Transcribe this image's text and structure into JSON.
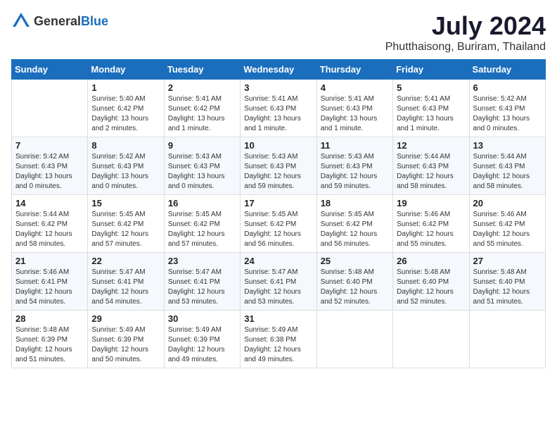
{
  "header": {
    "logo_general": "General",
    "logo_blue": "Blue",
    "month_title": "July 2024",
    "location": "Phutthaisong, Buriram, Thailand"
  },
  "days_of_week": [
    "Sunday",
    "Monday",
    "Tuesday",
    "Wednesday",
    "Thursday",
    "Friday",
    "Saturday"
  ],
  "weeks": [
    [
      {
        "day": "",
        "info": ""
      },
      {
        "day": "1",
        "info": "Sunrise: 5:40 AM\nSunset: 6:42 PM\nDaylight: 13 hours\nand 2 minutes."
      },
      {
        "day": "2",
        "info": "Sunrise: 5:41 AM\nSunset: 6:42 PM\nDaylight: 13 hours\nand 1 minute."
      },
      {
        "day": "3",
        "info": "Sunrise: 5:41 AM\nSunset: 6:43 PM\nDaylight: 13 hours\nand 1 minute."
      },
      {
        "day": "4",
        "info": "Sunrise: 5:41 AM\nSunset: 6:43 PM\nDaylight: 13 hours\nand 1 minute."
      },
      {
        "day": "5",
        "info": "Sunrise: 5:41 AM\nSunset: 6:43 PM\nDaylight: 13 hours\nand 1 minute."
      },
      {
        "day": "6",
        "info": "Sunrise: 5:42 AM\nSunset: 6:43 PM\nDaylight: 13 hours\nand 0 minutes."
      }
    ],
    [
      {
        "day": "7",
        "info": "Sunrise: 5:42 AM\nSunset: 6:43 PM\nDaylight: 13 hours\nand 0 minutes."
      },
      {
        "day": "8",
        "info": "Sunrise: 5:42 AM\nSunset: 6:43 PM\nDaylight: 13 hours\nand 0 minutes."
      },
      {
        "day": "9",
        "info": "Sunrise: 5:43 AM\nSunset: 6:43 PM\nDaylight: 13 hours\nand 0 minutes."
      },
      {
        "day": "10",
        "info": "Sunrise: 5:43 AM\nSunset: 6:43 PM\nDaylight: 12 hours\nand 59 minutes."
      },
      {
        "day": "11",
        "info": "Sunrise: 5:43 AM\nSunset: 6:43 PM\nDaylight: 12 hours\nand 59 minutes."
      },
      {
        "day": "12",
        "info": "Sunrise: 5:44 AM\nSunset: 6:43 PM\nDaylight: 12 hours\nand 58 minutes."
      },
      {
        "day": "13",
        "info": "Sunrise: 5:44 AM\nSunset: 6:43 PM\nDaylight: 12 hours\nand 58 minutes."
      }
    ],
    [
      {
        "day": "14",
        "info": "Sunrise: 5:44 AM\nSunset: 6:42 PM\nDaylight: 12 hours\nand 58 minutes."
      },
      {
        "day": "15",
        "info": "Sunrise: 5:45 AM\nSunset: 6:42 PM\nDaylight: 12 hours\nand 57 minutes."
      },
      {
        "day": "16",
        "info": "Sunrise: 5:45 AM\nSunset: 6:42 PM\nDaylight: 12 hours\nand 57 minutes."
      },
      {
        "day": "17",
        "info": "Sunrise: 5:45 AM\nSunset: 6:42 PM\nDaylight: 12 hours\nand 56 minutes."
      },
      {
        "day": "18",
        "info": "Sunrise: 5:45 AM\nSunset: 6:42 PM\nDaylight: 12 hours\nand 56 minutes."
      },
      {
        "day": "19",
        "info": "Sunrise: 5:46 AM\nSunset: 6:42 PM\nDaylight: 12 hours\nand 55 minutes."
      },
      {
        "day": "20",
        "info": "Sunrise: 5:46 AM\nSunset: 6:42 PM\nDaylight: 12 hours\nand 55 minutes."
      }
    ],
    [
      {
        "day": "21",
        "info": "Sunrise: 5:46 AM\nSunset: 6:41 PM\nDaylight: 12 hours\nand 54 minutes."
      },
      {
        "day": "22",
        "info": "Sunrise: 5:47 AM\nSunset: 6:41 PM\nDaylight: 12 hours\nand 54 minutes."
      },
      {
        "day": "23",
        "info": "Sunrise: 5:47 AM\nSunset: 6:41 PM\nDaylight: 12 hours\nand 53 minutes."
      },
      {
        "day": "24",
        "info": "Sunrise: 5:47 AM\nSunset: 6:41 PM\nDaylight: 12 hours\nand 53 minutes."
      },
      {
        "day": "25",
        "info": "Sunrise: 5:48 AM\nSunset: 6:40 PM\nDaylight: 12 hours\nand 52 minutes."
      },
      {
        "day": "26",
        "info": "Sunrise: 5:48 AM\nSunset: 6:40 PM\nDaylight: 12 hours\nand 52 minutes."
      },
      {
        "day": "27",
        "info": "Sunrise: 5:48 AM\nSunset: 6:40 PM\nDaylight: 12 hours\nand 51 minutes."
      }
    ],
    [
      {
        "day": "28",
        "info": "Sunrise: 5:48 AM\nSunset: 6:39 PM\nDaylight: 12 hours\nand 51 minutes."
      },
      {
        "day": "29",
        "info": "Sunrise: 5:49 AM\nSunset: 6:39 PM\nDaylight: 12 hours\nand 50 minutes."
      },
      {
        "day": "30",
        "info": "Sunrise: 5:49 AM\nSunset: 6:39 PM\nDaylight: 12 hours\nand 49 minutes."
      },
      {
        "day": "31",
        "info": "Sunrise: 5:49 AM\nSunset: 6:38 PM\nDaylight: 12 hours\nand 49 minutes."
      },
      {
        "day": "",
        "info": ""
      },
      {
        "day": "",
        "info": ""
      },
      {
        "day": "",
        "info": ""
      }
    ]
  ]
}
